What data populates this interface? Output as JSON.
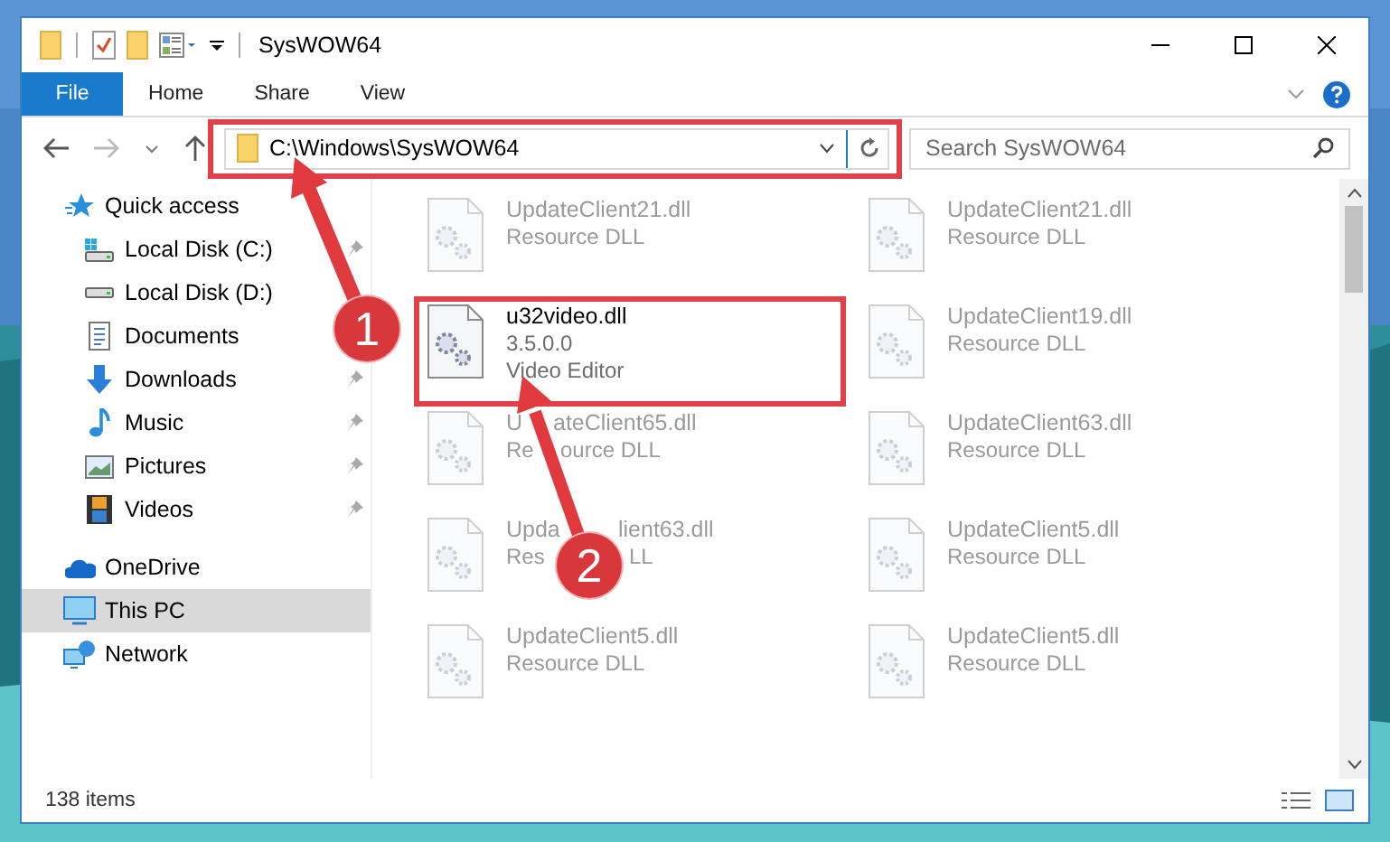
{
  "window": {
    "title": "SysWOW64"
  },
  "ribbon_tabs": [
    {
      "label": "File",
      "selected": true
    },
    {
      "label": "Home",
      "selected": false
    },
    {
      "label": "Share",
      "selected": false
    },
    {
      "label": "View",
      "selected": false
    }
  ],
  "address": {
    "path": "C:\\Windows\\SysWOW64"
  },
  "search": {
    "placeholder": "Search SysWOW64"
  },
  "nav_pane": [
    {
      "label": "Quick access",
      "selected": false,
      "children": [
        {
          "label": "Local Disk (C:)",
          "selected": false,
          "pinned": true
        },
        {
          "label": "Local Disk (D:)",
          "selected": false,
          "pinned": false
        },
        {
          "label": "Documents",
          "selected": false,
          "pinned": false
        },
        {
          "label": "Downloads",
          "selected": false,
          "pinned": true
        },
        {
          "label": "Music",
          "selected": false,
          "pinned": true
        },
        {
          "label": "Pictures",
          "selected": false,
          "pinned": true
        },
        {
          "label": "Videos",
          "selected": false,
          "pinned": true
        }
      ]
    },
    {
      "label": "OneDrive",
      "selected": false
    },
    {
      "label": "This PC",
      "selected": true
    },
    {
      "label": "Network",
      "selected": false
    }
  ],
  "files": [
    {
      "name": "UpdateClient21.dll",
      "description": "Resource DLL",
      "blurred": true
    },
    {
      "name": "UpdateClient21.dll",
      "description": "Resource DLL",
      "blurred": true
    },
    {
      "name": "u32video.dll",
      "version": "3.5.0.0",
      "description": "Video Editor",
      "blurred": false
    },
    {
      "name": "UpdateClient19.dll",
      "description": "Resource DLL",
      "blurred": true
    },
    {
      "name": [
        "U",
        "ateClient65.dll"
      ],
      "description": [
        "Re",
        "ource DLL"
      ],
      "blurred": true
    },
    {
      "name": "UpdateClient63.dll",
      "description": "Resource DLL",
      "blurred": true
    },
    {
      "name": [
        "Upda",
        "lient63.dll"
      ],
      "description": [
        "Res",
        "LL"
      ],
      "blurred": true
    },
    {
      "name": "UpdateClient5.dll",
      "description": "Resource DLL",
      "blurred": true
    },
    {
      "name": "UpdateClient5.dll",
      "description": "Resource DLL",
      "blurred": true
    },
    {
      "name": "UpdateClient5.dll",
      "description": "Resource DLL",
      "blurred": true
    }
  ],
  "status_bar": {
    "item_count": "138 items"
  },
  "annotations": [
    {
      "number": "1"
    },
    {
      "number": "2"
    }
  ]
}
